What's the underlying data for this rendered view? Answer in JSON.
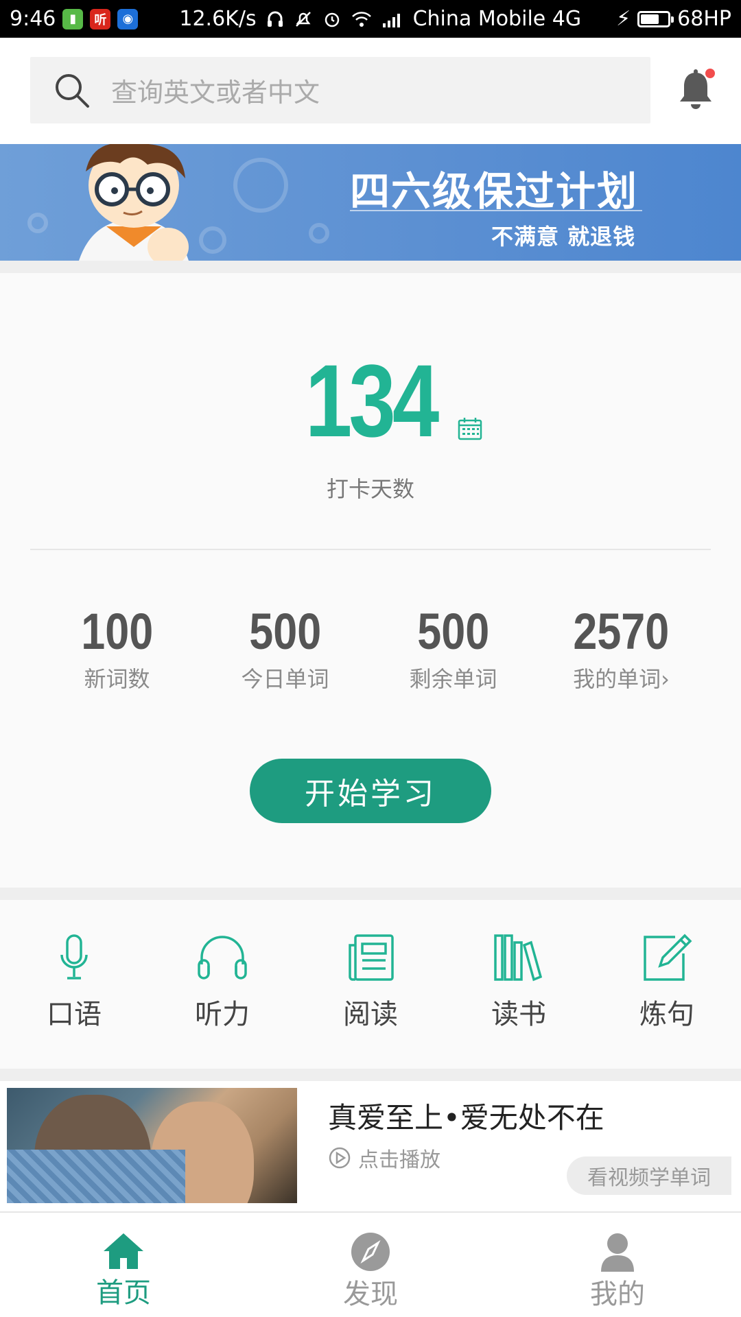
{
  "status_bar": {
    "time": "9:46",
    "app_icon_2_text": "听",
    "net_speed": "12.6K/s",
    "carrier": "China Mobile 4G",
    "battery": "68HP",
    "battery_level": 0.68
  },
  "search": {
    "placeholder": "查询英文或者中文"
  },
  "banner": {
    "title": "四六级保过计划",
    "subtitle": "不满意  就退钱"
  },
  "checkin": {
    "days": "134",
    "label": "打卡天数"
  },
  "stats": [
    {
      "value": "100",
      "label": "新词数"
    },
    {
      "value": "500",
      "label": "今日单词"
    },
    {
      "value": "500",
      "label": "剩余单词"
    },
    {
      "value": "2570",
      "label": "我的单词›"
    }
  ],
  "start_button": "开始学习",
  "features": [
    {
      "label": "口语",
      "icon": "microphone-icon"
    },
    {
      "label": "听力",
      "icon": "headphones-icon"
    },
    {
      "label": "阅读",
      "icon": "reading-icon"
    },
    {
      "label": "读书",
      "icon": "books-icon"
    },
    {
      "label": "炼句",
      "icon": "edit-icon"
    }
  ],
  "video": {
    "title": "真爱至上•爱无处不在",
    "play_label": "点击播放",
    "tag": "看视频学单词"
  },
  "bottom_nav": [
    {
      "label": "首页",
      "icon": "home-icon",
      "active": true
    },
    {
      "label": "发现",
      "icon": "compass-icon",
      "active": false
    },
    {
      "label": "我的",
      "icon": "user-icon",
      "active": false
    }
  ],
  "colors": {
    "accent": "#1e9c80",
    "accent_light": "#22b494",
    "banner_blue": "#5b8fd2",
    "notification_dot": "#f24d4d"
  }
}
